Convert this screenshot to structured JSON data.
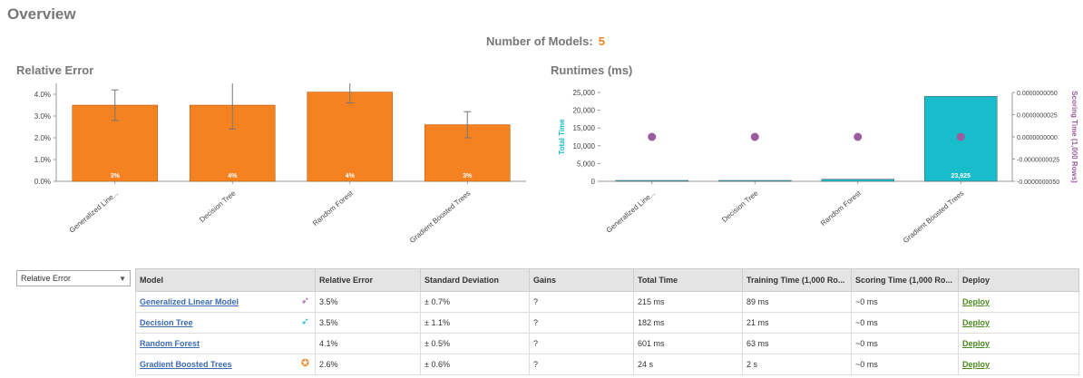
{
  "page": {
    "title": "Overview"
  },
  "summary": {
    "label": "Number of Models:",
    "count": "5"
  },
  "charts": {
    "relative_error_title": "Relative Error",
    "runtimes_title": "Runtimes (ms)"
  },
  "colors": {
    "bar": "#f58220",
    "teal": "#18bccb",
    "purple": "#9b5b9e",
    "link": "#3b6bb3",
    "deploy": "#4a8a1f"
  },
  "chart_data": [
    {
      "type": "bar",
      "title": "Relative Error",
      "categories": [
        "Generalized Line...",
        "Decision Tree",
        "Random Forest",
        "Gradient Boosted Trees"
      ],
      "values": [
        3.5,
        3.5,
        4.1,
        2.6
      ],
      "error": [
        0.7,
        1.1,
        0.5,
        0.6
      ],
      "data_labels": [
        "3%",
        "4%",
        "4%",
        "3%"
      ],
      "yticks": [
        "0.0%",
        "1.0%",
        "2.0%",
        "3.0%",
        "4.0%"
      ],
      "ylim": [
        0,
        4.5
      ],
      "legend": "none"
    },
    {
      "type": "bar",
      "title": "Runtimes (ms)",
      "categories": [
        "Generalized Line...",
        "Decision Tree",
        "Random Forest",
        "Gradient Boosted Trees"
      ],
      "series": [
        {
          "name": "Total Time",
          "values": [
            215,
            182,
            601,
            23925
          ],
          "data_labels": [
            "",
            "",
            "",
            "23,925"
          ]
        },
        {
          "name": "Scoring Time (1,000 Rows)",
          "type": "scatter",
          "values": [
            0,
            0,
            0,
            0
          ]
        }
      ],
      "ylabel": "Total Time",
      "y2label": "Scoring Time (1,000 Rows)",
      "yticks": [
        "0",
        "5,000",
        "10,000",
        "15,000",
        "20,000",
        "25,000"
      ],
      "ylim": [
        0,
        25000
      ],
      "y2ticks": [
        "-0.0000000050",
        "-0.0000000025",
        "0.0000000000",
        "0.0000000025",
        "0.0000000050"
      ],
      "y2lim": [
        -5e-09,
        5e-09
      ]
    }
  ],
  "metric_select": {
    "value": "Relative Error"
  },
  "table": {
    "headers": [
      "Model",
      "Relative Error",
      "Standard Deviation",
      "Gains",
      "Total Time",
      "Training Time (1,000 Ro...",
      "Scoring Time (1,000 Ro...",
      "Deploy"
    ],
    "rows": [
      {
        "model": "Generalized Linear Model",
        "badge": "runner-icon",
        "badge_color": "#9b5b9e",
        "relative_error": "3.5%",
        "std": "± 0.7%",
        "gains": "?",
        "total_time": "215 ms",
        "training_time": "89 ms",
        "scoring_time": "~0 ms",
        "deploy": "Deploy"
      },
      {
        "model": "Decision Tree",
        "badge": "runner-icon",
        "badge_color": "#18bccb",
        "relative_error": "3.5%",
        "std": "± 1.1%",
        "gains": "?",
        "total_time": "182 ms",
        "training_time": "21 ms",
        "scoring_time": "~0 ms",
        "deploy": "Deploy"
      },
      {
        "model": "Random Forest",
        "badge": "",
        "badge_color": "",
        "relative_error": "4.1%",
        "std": "± 0.5%",
        "gains": "?",
        "total_time": "601 ms",
        "training_time": "63 ms",
        "scoring_time": "~0 ms",
        "deploy": "Deploy"
      },
      {
        "model": "Gradient Boosted Trees",
        "badge": "award-icon",
        "badge_color": "#f58220",
        "relative_error": "2.6%",
        "std": "± 0.6%",
        "gains": "?",
        "total_time": "24 s",
        "training_time": "2 s",
        "scoring_time": "~0 ms",
        "deploy": "Deploy"
      }
    ]
  }
}
